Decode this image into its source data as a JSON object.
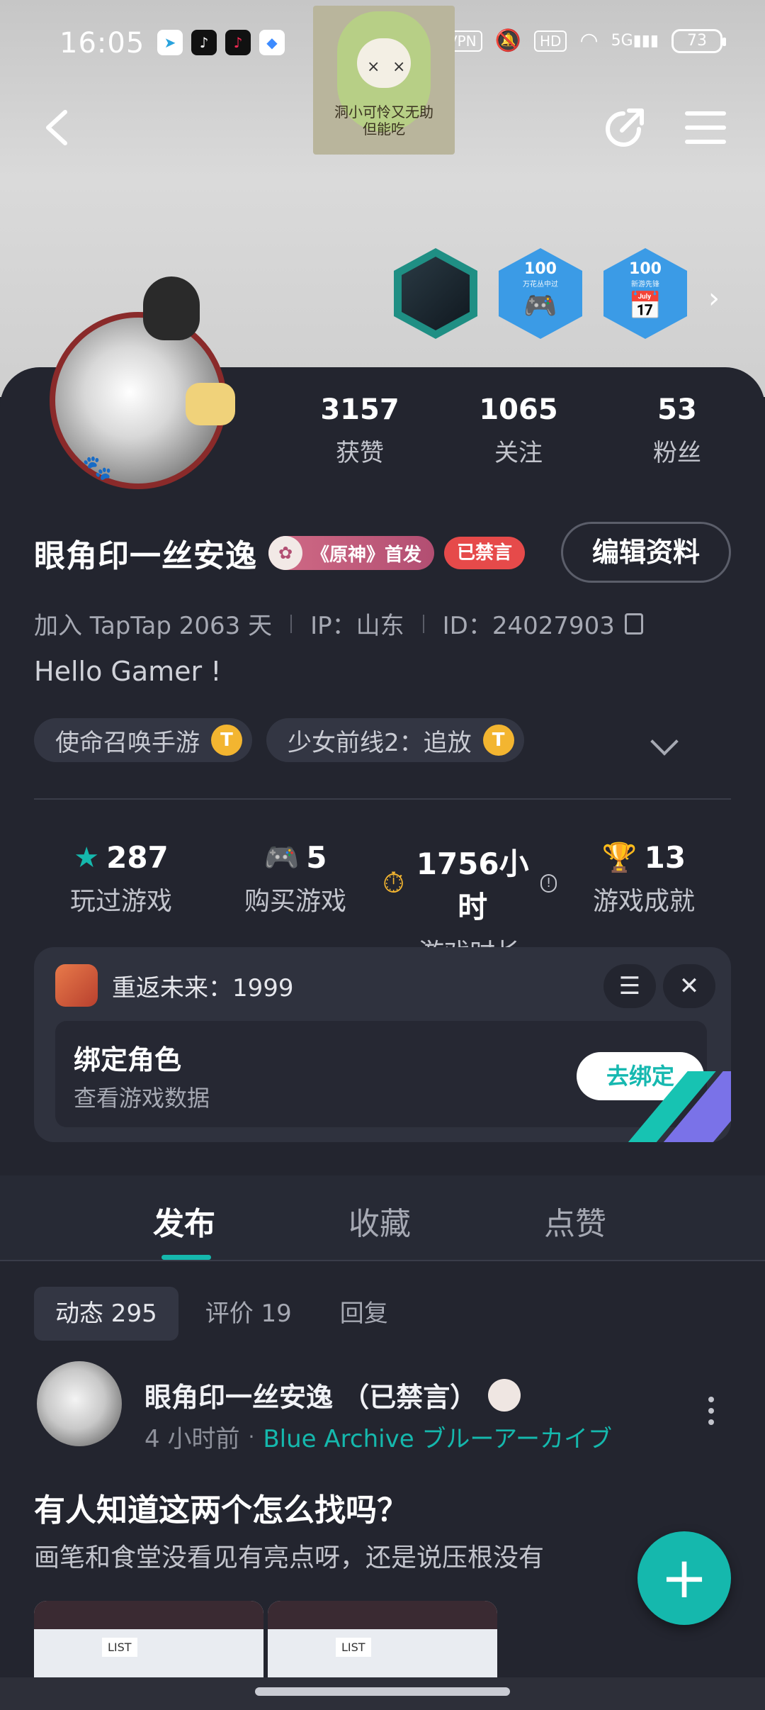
{
  "status_bar": {
    "time": "16:05",
    "vpn": "VPN",
    "hd": "HD",
    "network": "5G",
    "battery": "73"
  },
  "sticker": {
    "caption_line1": "洞小可怜又无助",
    "caption_line2": "但能吃"
  },
  "badges": [
    {
      "icon": "game-achievement-badge"
    },
    {
      "number": "100",
      "subtitle": "万花丛中过",
      "icon": "gamepad-icon"
    },
    {
      "number": "100",
      "subtitle": "新游先锋",
      "icon": "calendar-gamepad-icon"
    }
  ],
  "profile_stats": [
    {
      "value": "3157",
      "label": "获赞"
    },
    {
      "value": "1065",
      "label": "关注"
    },
    {
      "value": "53",
      "label": "粉丝"
    }
  ],
  "user": {
    "name": "眼角印一丝安逸",
    "genshin_tag": "《原神》首发",
    "banned_tag": "已禁言",
    "edit_button": "编辑资料",
    "joined": "加入 TapTap 2063 天",
    "ip": "IP：山东",
    "id": "ID：24027903",
    "bio": "Hello Gamer !"
  },
  "game_chips": [
    {
      "label": "使命召唤手游",
      "icon_letter": "T"
    },
    {
      "label": "少女前线2：追放",
      "icon_letter": "T"
    }
  ],
  "game_stats": [
    {
      "value": "287",
      "label": "玩过游戏",
      "icon": "star-icon",
      "color": "#15b8ad"
    },
    {
      "value": "5",
      "label": "购买游戏",
      "icon": "gamepad-icon",
      "color": "#3d8bff"
    },
    {
      "value": "1756小时",
      "label": "游戏时长",
      "icon": "stopwatch-icon",
      "color": "#f3b530"
    },
    {
      "value": "13",
      "label": "游戏成就",
      "icon": "trophy-icon",
      "color": "#3fc15a"
    }
  ],
  "bind_card": {
    "game_title": "重返未来：1999",
    "title": "绑定角色",
    "subtitle": "查看游戏数据",
    "button": "去绑定"
  },
  "tabs": [
    {
      "label": "发布",
      "active": true
    },
    {
      "label": "收藏",
      "active": false
    },
    {
      "label": "点赞",
      "active": false
    }
  ],
  "subtabs": [
    {
      "label": "动态 295",
      "active": true
    },
    {
      "label": "评价 19",
      "active": false
    },
    {
      "label": "回复",
      "active": false
    }
  ],
  "post": {
    "author": "眼角印一丝安逸 （已禁言）",
    "time": "4 小时前",
    "game": "Blue Archive ブルーアーカイブ",
    "title": "有人知道这两个怎么找吗？",
    "body": "画笔和食堂没看见有亮点呀，还是说压根没有",
    "thumb_label": "LIST"
  },
  "colors": {
    "accent": "#15b8ad",
    "banned": "#e64a4a",
    "background": "#23252f"
  }
}
